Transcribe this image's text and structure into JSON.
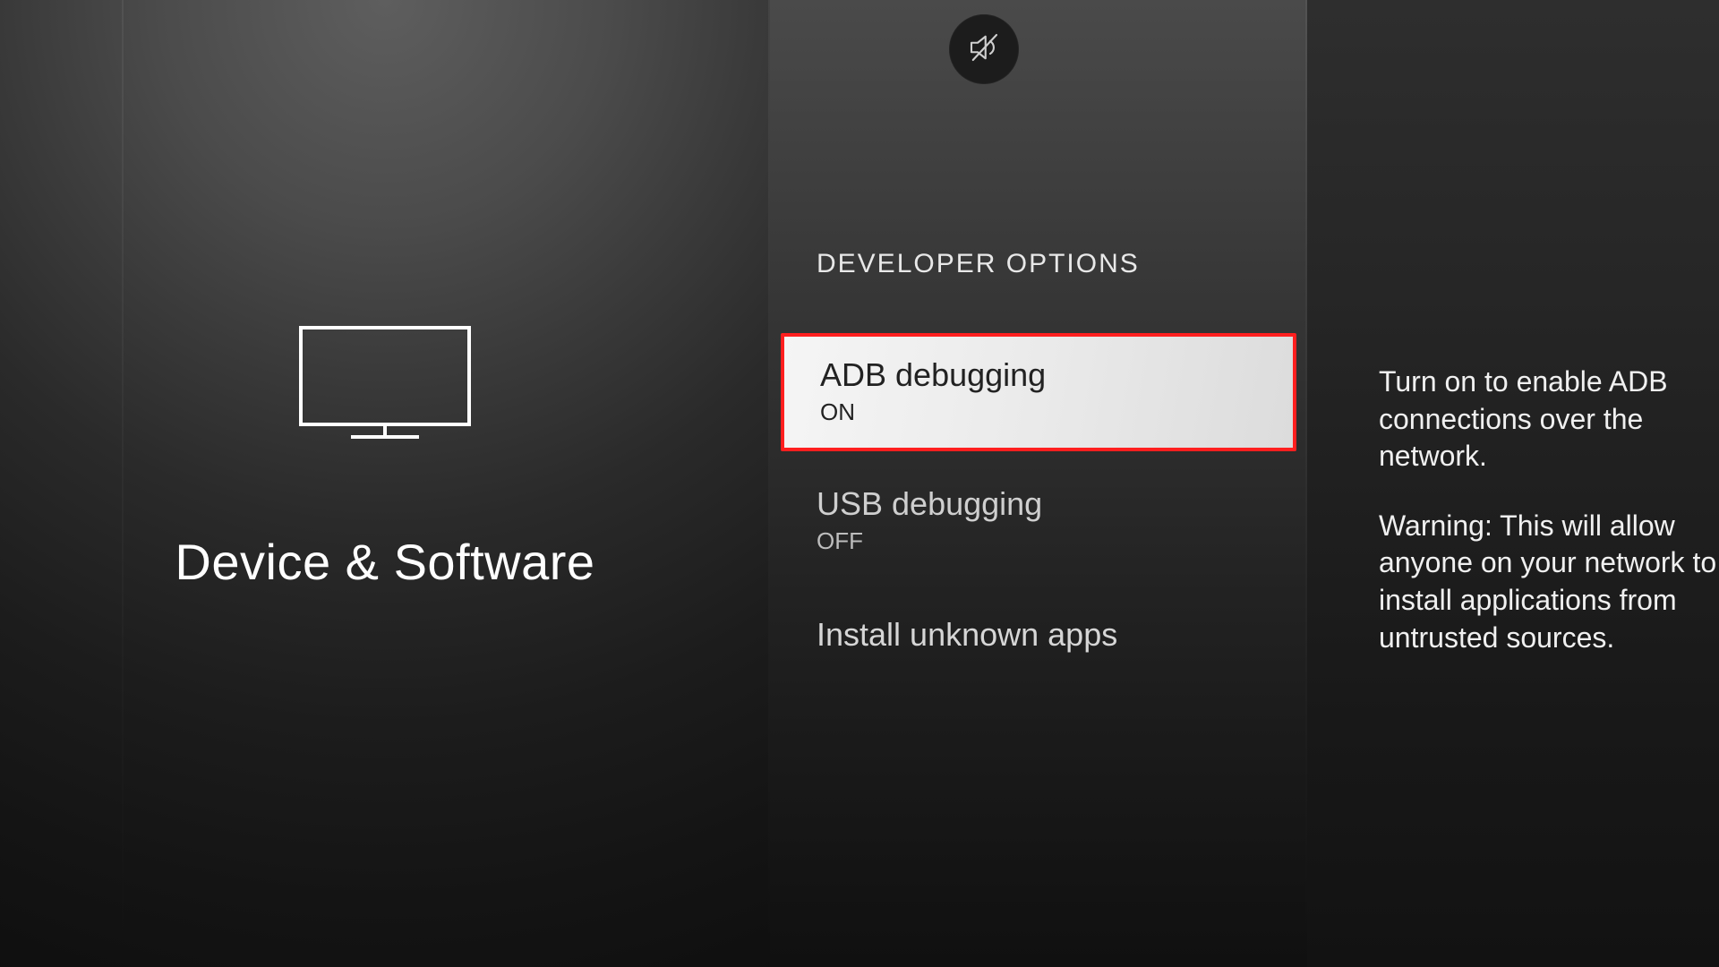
{
  "left": {
    "icon": "tv-icon",
    "title": "Device & Software"
  },
  "status": {
    "mute_icon": "mute-icon"
  },
  "center": {
    "heading": "DEVELOPER OPTIONS",
    "options": [
      {
        "key": "adb",
        "title": "ADB debugging",
        "value": "ON",
        "selected": true
      },
      {
        "key": "usb",
        "title": "USB debugging",
        "value": "OFF",
        "selected": false
      },
      {
        "key": "install",
        "title": "Install unknown apps",
        "value": null,
        "selected": false
      }
    ]
  },
  "help": {
    "p1": "Turn on to enable ADB connections over the network.",
    "p2": "Warning: This will allow anyone on your network to install applications from untrusted sources."
  },
  "colors": {
    "highlight_border": "#ff1f1f",
    "highlight_bg": "#eeeeee",
    "text_primary": "#ffffff",
    "text_muted": "#cfcfcf"
  }
}
